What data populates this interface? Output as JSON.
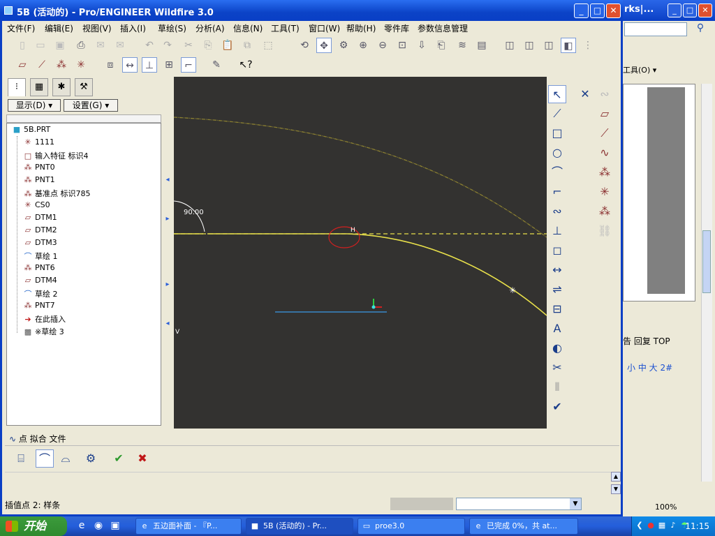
{
  "window": {
    "title": "5B (活动的) - Pro/ENGINEER Wildfire 3.0",
    "minimize": "_",
    "maximize": "□",
    "close": "✕"
  },
  "menu": [
    "文件(F)",
    "编辑(E)",
    "视图(V)",
    "插入(I)",
    "草绘(S)",
    "分析(A)",
    "信息(N)",
    "工具(T)",
    "窗口(W)",
    "帮助(H)",
    "零件库",
    "参数信息管理"
  ],
  "sidebar": {
    "display_button": "显示(D) ▾",
    "settings_button": "设置(G) ▾",
    "tree": [
      {
        "label": "5B.PRT",
        "icon": "part-icon",
        "glyph": "■"
      },
      {
        "label": "1111",
        "icon": "csys-icon",
        "glyph": "✳"
      },
      {
        "label": "输入特征 标识4",
        "icon": "import-feature-icon",
        "glyph": "□"
      },
      {
        "label": "PNT0",
        "icon": "datum-point-icon",
        "glyph": "⁂"
      },
      {
        "label": "PNT1",
        "icon": "datum-point-icon",
        "glyph": "⁂"
      },
      {
        "label": "基准点 标识785",
        "icon": "datum-point-icon",
        "glyph": "⁂"
      },
      {
        "label": "CS0",
        "icon": "csys-icon",
        "glyph": "✳"
      },
      {
        "label": "DTM1",
        "icon": "datum-plane-icon",
        "glyph": "▱"
      },
      {
        "label": "DTM2",
        "icon": "datum-plane-icon",
        "glyph": "▱"
      },
      {
        "label": "DTM3",
        "icon": "datum-plane-icon",
        "glyph": "▱"
      },
      {
        "label": "草绘 1",
        "icon": "sketch-icon",
        "glyph": "⌒"
      },
      {
        "label": "PNT6",
        "icon": "datum-point-icon",
        "glyph": "⁂"
      },
      {
        "label": "DTM4",
        "icon": "datum-plane-icon",
        "glyph": "▱"
      },
      {
        "label": "草绘 2",
        "icon": "sketch-icon",
        "glyph": "⌒"
      },
      {
        "label": "PNT7",
        "icon": "datum-point-icon",
        "glyph": "⁂"
      },
      {
        "label": "在此插入",
        "icon": "insert-here-arrow-icon",
        "glyph": "➔"
      },
      {
        "label": "※草绘 3",
        "icon": "sketch-active-icon",
        "glyph": "▩"
      }
    ]
  },
  "canvas": {
    "dimension_label": "90.00",
    "h_label": "H",
    "v_label": "V"
  },
  "dashboard": {
    "tabs": "点  拟合  文件",
    "tab_icon": "spline-icon"
  },
  "status": {
    "message": "插值点 2: 样条"
  },
  "bg_window": {
    "title": "rks|...",
    "tools_label": "工具(O) ▾",
    "text1": "告 回复 TOP",
    "text2": "小 中 大  2#",
    "zoom": "100%"
  },
  "taskbar": {
    "start_label": "开始",
    "tasks": [
      "五边面补面 - 『P...",
      "5B (活动的) - Pr...",
      "proe3.0",
      "已完成 0%，共 at..."
    ],
    "clock": "11:15"
  },
  "colors": {
    "canvas_bg": "#333230",
    "sketch_yellow": "#e8e04a",
    "selection_red": "#d02020",
    "reference_blue": "#3a9ae8",
    "title_blue": "#0a3fc5"
  }
}
